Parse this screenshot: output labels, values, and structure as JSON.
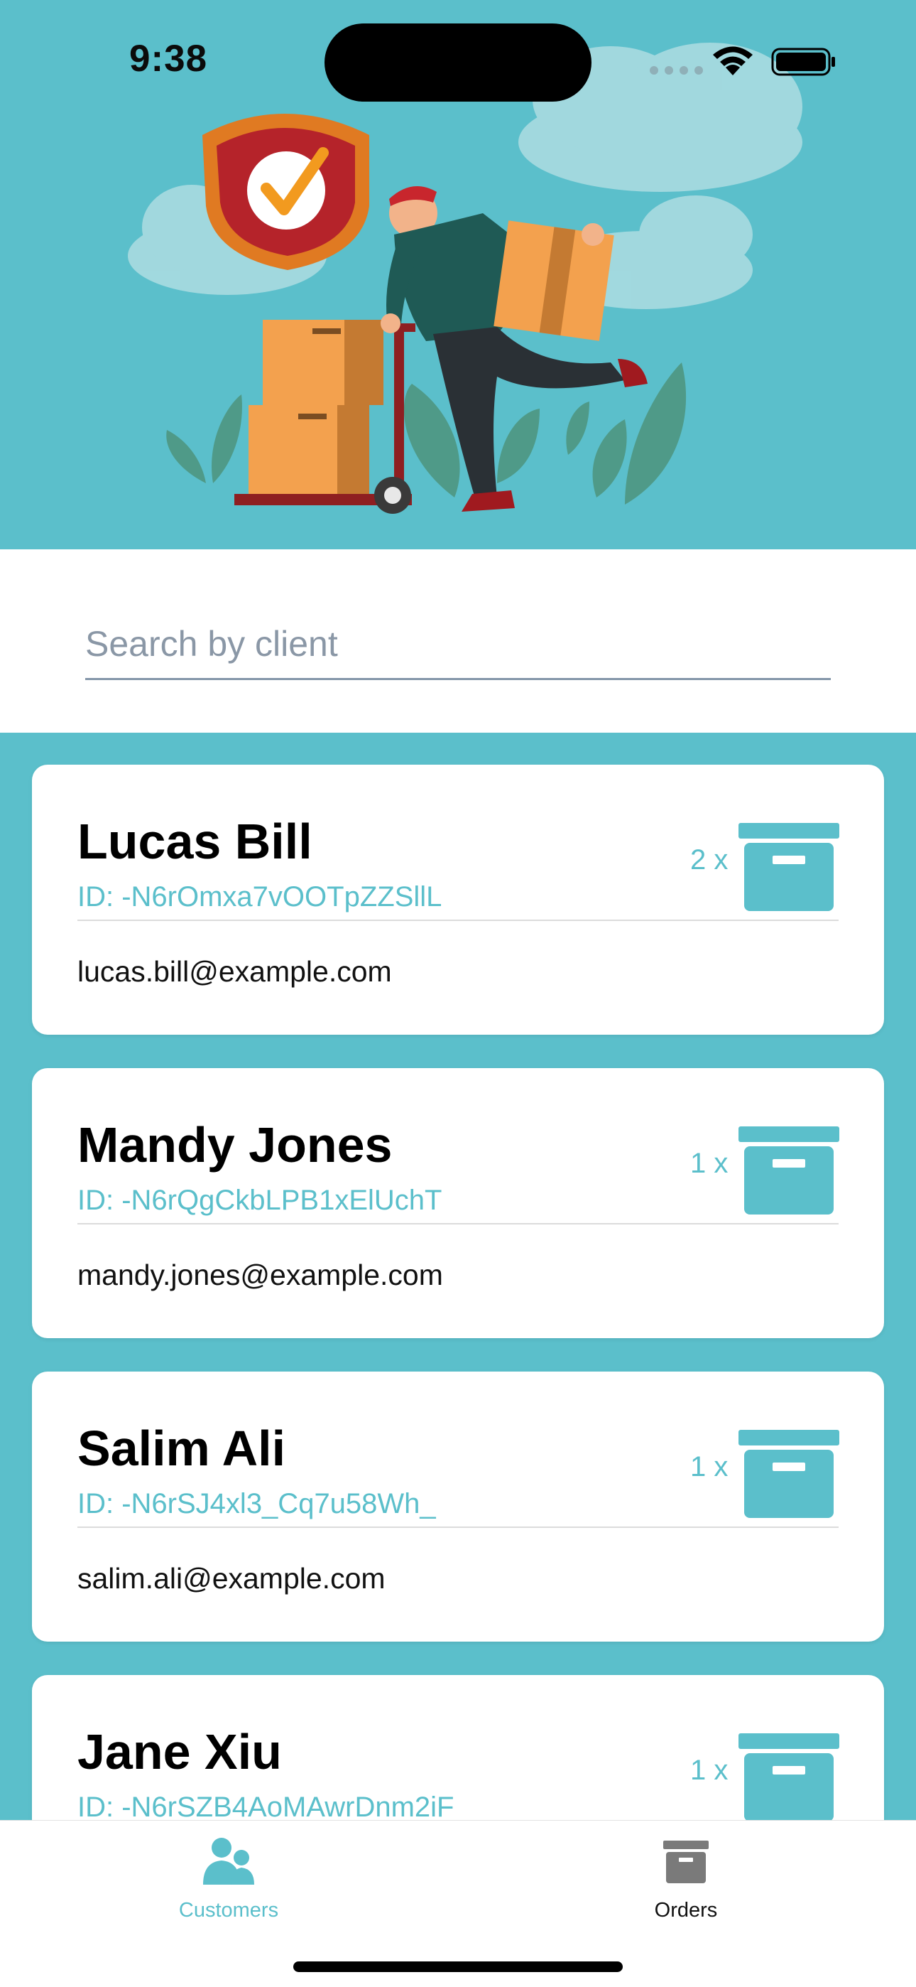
{
  "status_bar": {
    "time": "9:38"
  },
  "search": {
    "placeholder": "Search by client",
    "value": ""
  },
  "customers": [
    {
      "name": "Lucas Bill",
      "id": "ID: -N6rOmxa7vOOTpZZSllL",
      "email": "lucas.bill@example.com",
      "quantity": "2 x",
      "icon": "archive-box-icon"
    },
    {
      "name": "Mandy Jones",
      "id": "ID: -N6rQgCkbLPB1xElUchT",
      "email": "mandy.jones@example.com",
      "quantity": "1 x",
      "icon": "archive-box-icon"
    },
    {
      "name": "Salim Ali",
      "id": "ID: -N6rSJ4xl3_Cq7u58Wh_",
      "email": "salim.ali@example.com",
      "quantity": "1 x",
      "icon": "archive-box-icon"
    },
    {
      "name": "Jane Xiu",
      "id": "ID: -N6rSZB4AoMAwrDnm2iF",
      "email": "",
      "quantity": "1 x",
      "icon": "archive-box-icon"
    }
  ],
  "tab_bar": {
    "tabs": [
      {
        "label": "Customers",
        "icon": "customers-icon",
        "selected": true
      },
      {
        "label": "Orders",
        "icon": "orders-box-icon",
        "selected": false
      }
    ]
  },
  "colors": {
    "accent": "#5bbfcb",
    "background": "#5bbfcb",
    "card": "#ffffff"
  }
}
